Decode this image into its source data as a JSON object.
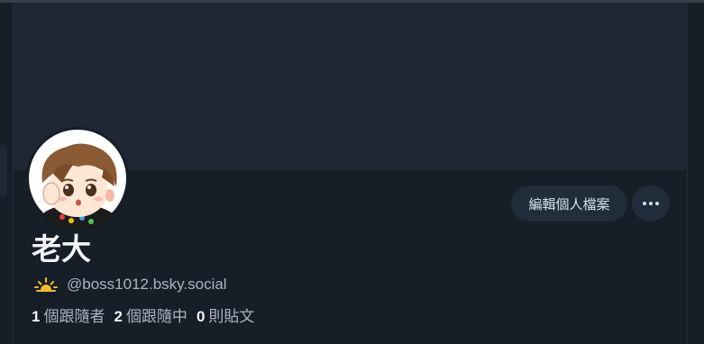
{
  "profile": {
    "display_name": "老大",
    "handle": "@boss1012.bsky.social",
    "avatar_icon": "avatar-cartoon-boy",
    "handle_icon": "sun-icon"
  },
  "actions": {
    "edit_label": "編輯個人檔案",
    "more_icon": "ellipsis-icon"
  },
  "stats": {
    "followers_count": "1",
    "followers_label": "個跟隨者",
    "following_count": "2",
    "following_label": "個跟隨中",
    "posts_count": "0",
    "posts_label": "則貼文"
  },
  "colors": {
    "background": "#161e27",
    "banner": "#1e2733",
    "button": "#212d3b",
    "text_primary": "#f1f3f5",
    "text_secondary": "#aab4c0",
    "sun": "#f5b82e"
  }
}
